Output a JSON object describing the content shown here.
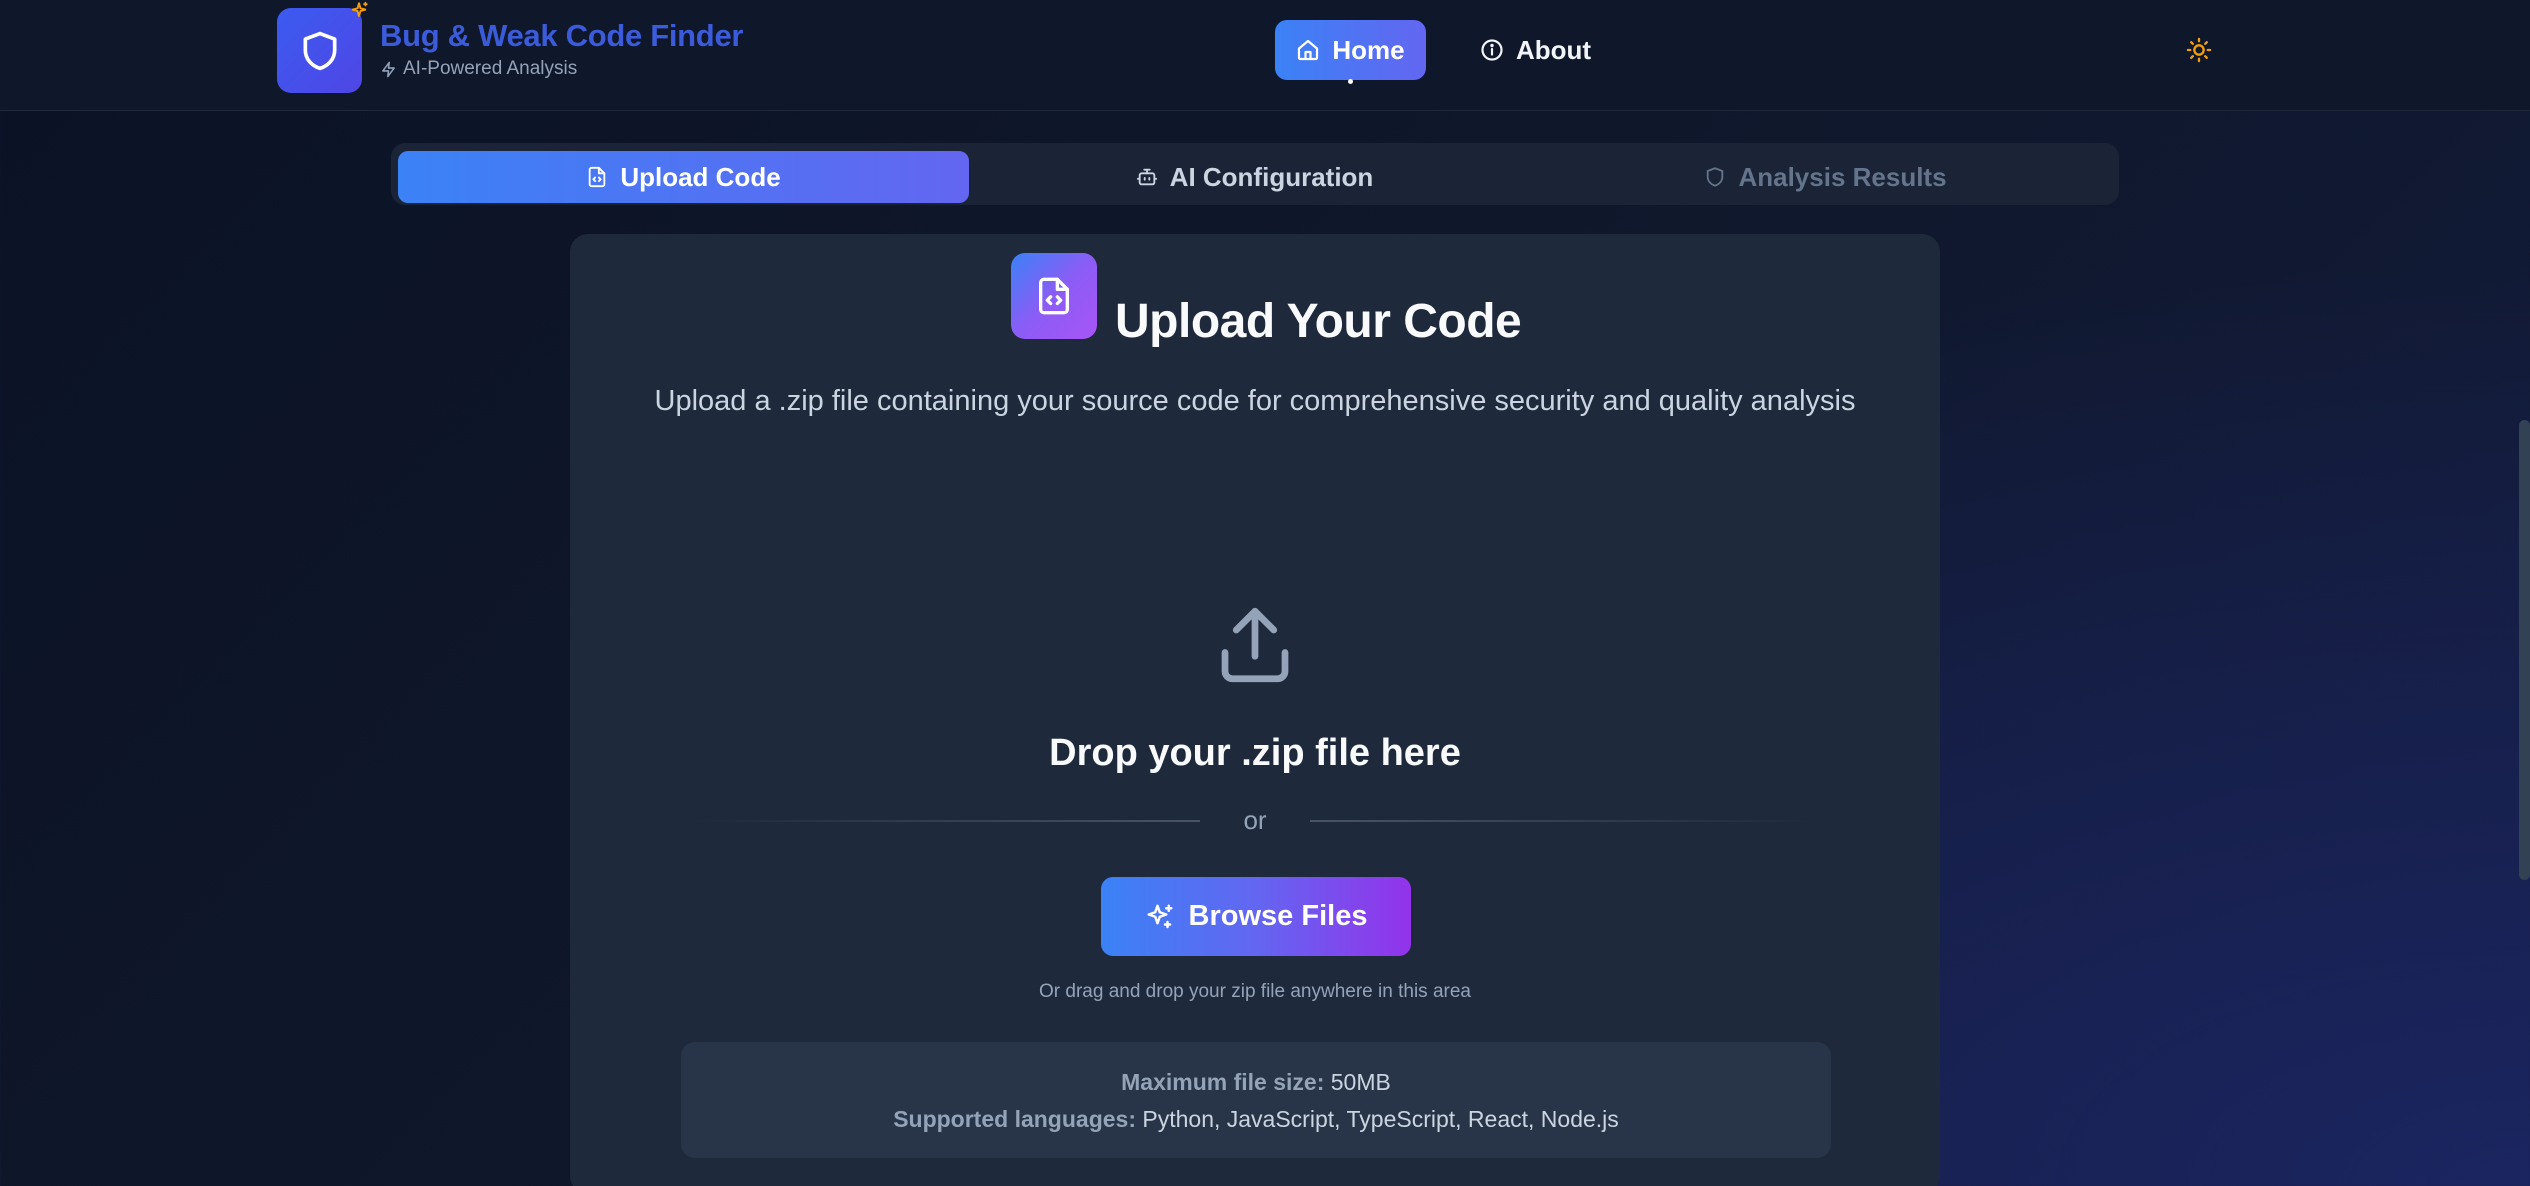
{
  "header": {
    "brand_title": "Bug & Weak Code Finder",
    "brand_subtitle": "AI-Powered Analysis",
    "nav_home": "Home",
    "nav_about": "About"
  },
  "tabs": [
    {
      "label": "Upload Code",
      "active": true
    },
    {
      "label": "AI Configuration",
      "active": false
    },
    {
      "label": "Analysis Results",
      "active": false
    }
  ],
  "upload": {
    "title": "Upload Your Code",
    "description": "Upload a .zip file containing your source code for comprehensive security and quality analysis",
    "drop_title": "Drop your .zip file here",
    "or": "or",
    "browse_label": "Browse Files",
    "drag_hint": "Or drag and drop your zip file anywhere in this area",
    "max_size_label": "Maximum file size:",
    "max_size_value": "50MB",
    "languages_label": "Supported languages:",
    "languages_value": "Python, JavaScript, TypeScript, React, Node.js"
  },
  "colors": {
    "accent_start": "#3b82f6",
    "accent_end": "#6366f1",
    "accent_purple": "#9333ea",
    "card_bg": "#1e293b",
    "theme_icon": "#f59e0b"
  }
}
